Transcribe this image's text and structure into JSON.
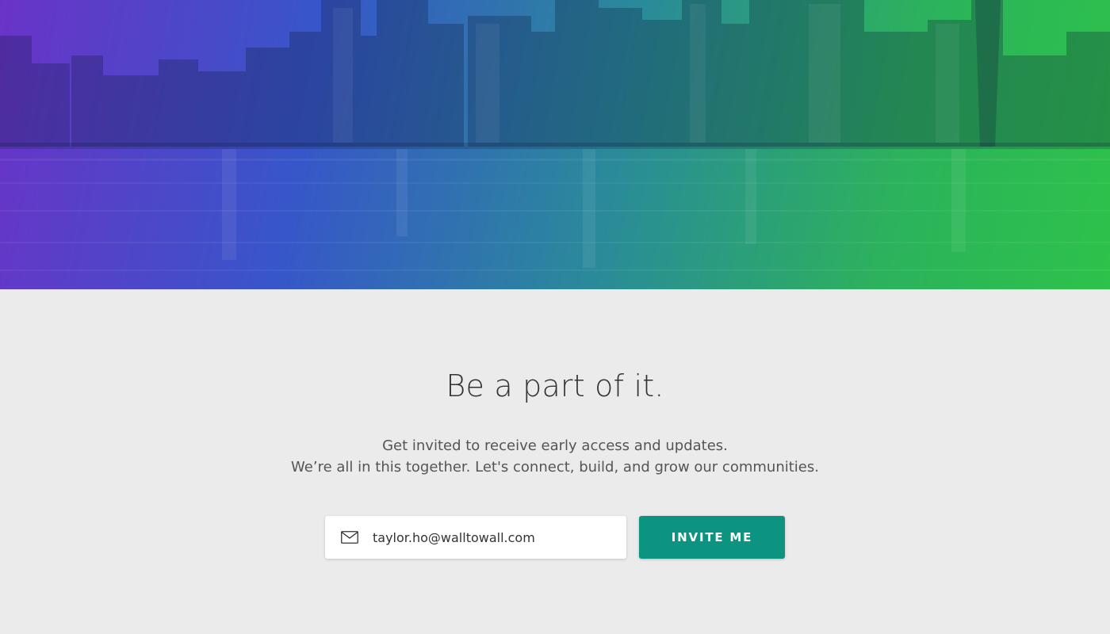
{
  "hero": {
    "image": "city-skyline-over-water",
    "gradient_colors": [
      "#6a33c8",
      "#3756c9",
      "#2a8a9a",
      "#2cb25c",
      "#2dc24a"
    ]
  },
  "signup": {
    "headline": "Be a part of it.",
    "subtext_line1": "Get invited to receive early access and updates.",
    "subtext_line2": "We’re all in this together. Let's connect, build, and grow our communities.",
    "email_value": "taylor.ho@walltowall.com",
    "email_icon": "mail-icon",
    "button_label": "INVITE ME",
    "button_color": "#0d9480"
  }
}
